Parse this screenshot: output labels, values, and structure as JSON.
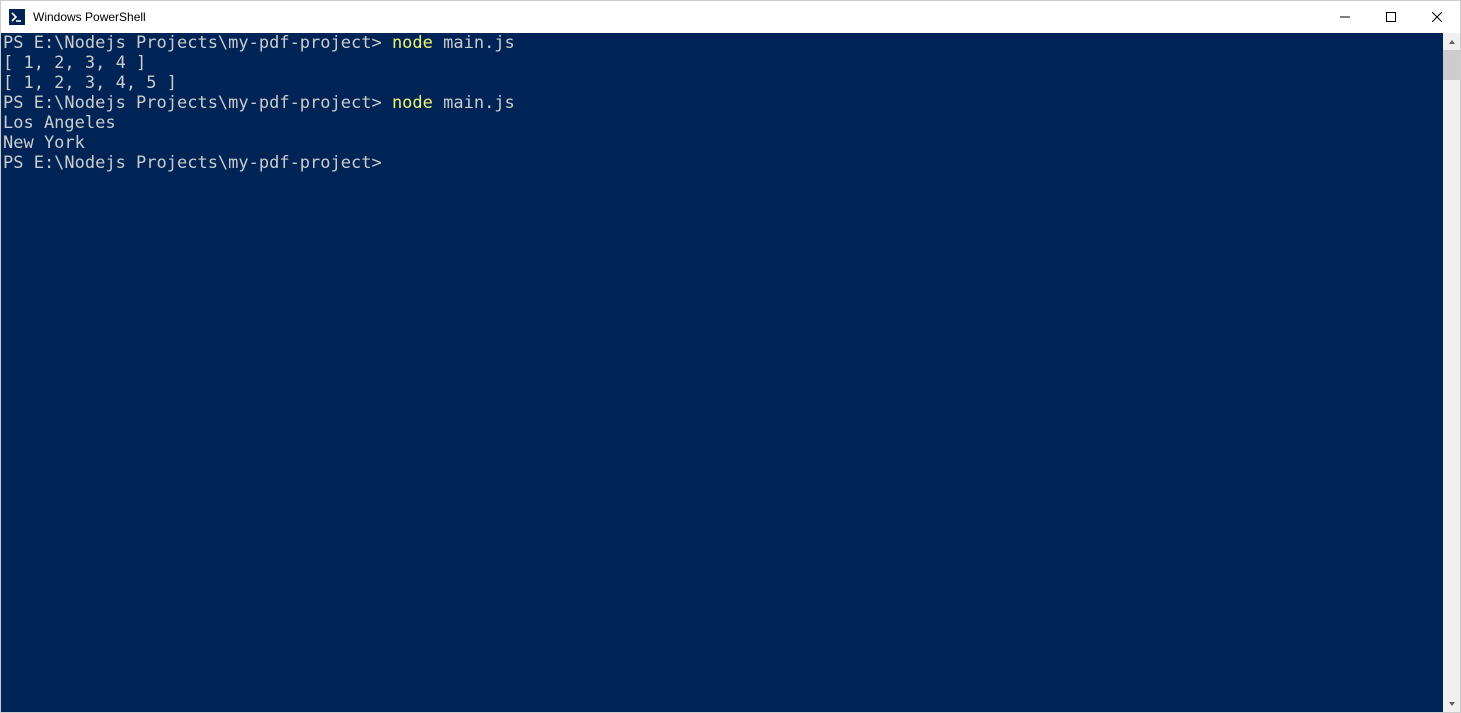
{
  "window": {
    "title": "Windows PowerShell"
  },
  "terminal": {
    "prompt_prefix": "PS ",
    "prompt_path": "E:\\Nodejs Projects\\my-pdf-project",
    "prompt_suffix": ">",
    "lines": [
      {
        "type": "prompt",
        "command": "node",
        "args": " main.js"
      },
      {
        "type": "output",
        "text": "[ 1, 2, 3, 4 ]"
      },
      {
        "type": "output",
        "text": "[ 1, 2, 3, 4, 5 ]"
      },
      {
        "type": "prompt",
        "command": "node",
        "args": " main.js"
      },
      {
        "type": "output",
        "text": "Los Angeles"
      },
      {
        "type": "output",
        "text": "New York"
      },
      {
        "type": "prompt",
        "command": "",
        "args": ""
      }
    ]
  }
}
